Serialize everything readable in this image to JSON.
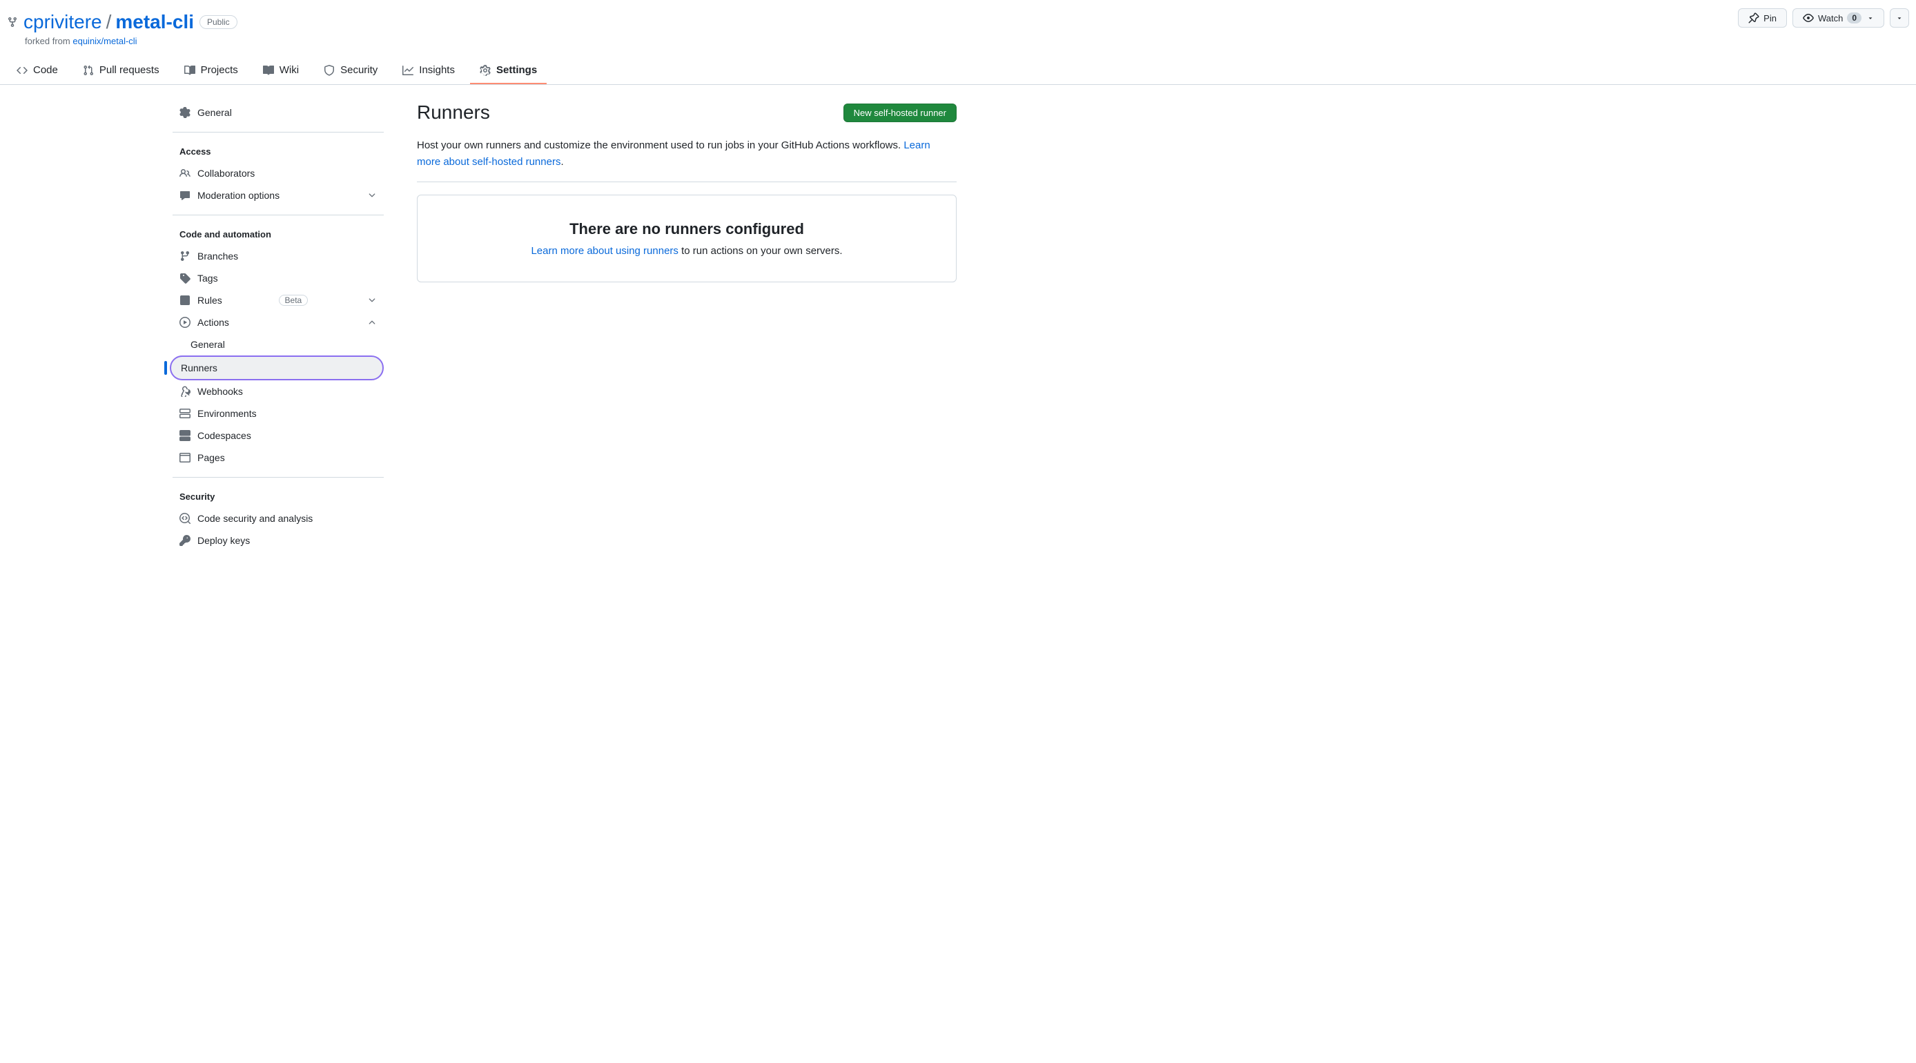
{
  "repo": {
    "owner": "cprivitere",
    "name": "metal-cli",
    "visibility": "Public",
    "forked_from_prefix": "forked from ",
    "forked_from": "equinix/metal-cli"
  },
  "header_actions": {
    "pin_label": "Pin",
    "watch_label": "Watch",
    "watch_count": "0"
  },
  "nav": {
    "code": "Code",
    "pull_requests": "Pull requests",
    "projects": "Projects",
    "wiki": "Wiki",
    "security": "Security",
    "insights": "Insights",
    "settings": "Settings"
  },
  "sidebar": {
    "general": "General",
    "access_header": "Access",
    "collaborators": "Collaborators",
    "moderation": "Moderation options",
    "code_header": "Code and automation",
    "branches": "Branches",
    "tags": "Tags",
    "rules": "Rules",
    "rules_badge": "Beta",
    "actions": "Actions",
    "actions_general": "General",
    "actions_runners": "Runners",
    "webhooks": "Webhooks",
    "environments": "Environments",
    "codespaces": "Codespaces",
    "pages": "Pages",
    "security_header": "Security",
    "code_security": "Code security and analysis",
    "deploy_keys": "Deploy keys"
  },
  "main": {
    "title": "Runners",
    "new_runner_label": "New self-hosted runner",
    "desc_prefix": "Host your own runners and customize the environment used to run jobs in your GitHub Actions workflows. ",
    "desc_link": "Learn more about self-hosted runners",
    "desc_suffix": ".",
    "empty_title": "There are no runners configured",
    "empty_link": "Learn more about using runners",
    "empty_suffix": " to run actions on your own servers."
  }
}
